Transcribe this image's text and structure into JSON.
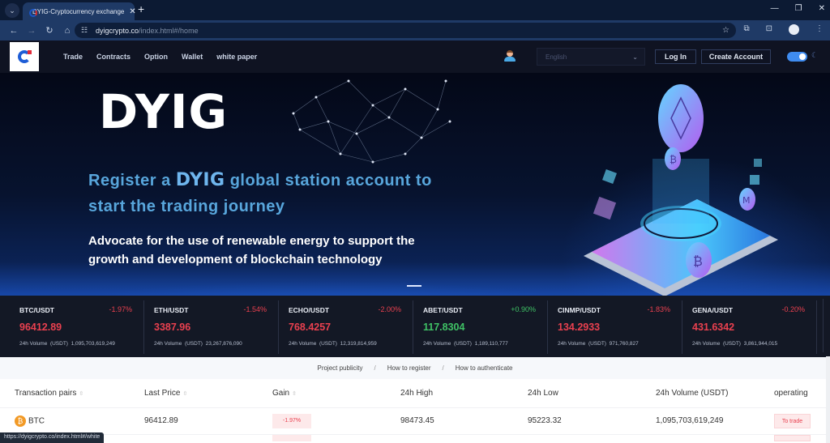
{
  "browser": {
    "tab_title": "DYIG-Cryptocurrency exchange",
    "url_host": "dyigcrypto.co",
    "url_path": "/index.html#/home",
    "status_url": "https://dyigcrypto.co/index.html#/white"
  },
  "header": {
    "nav": [
      "Trade",
      "Contracts",
      "Option",
      "Wallet",
      "white paper"
    ],
    "language": "English",
    "login_label": "Log In",
    "create_label": "Create Account",
    "theme_toggle_on": true
  },
  "hero": {
    "title": "DYIG",
    "sub_prefix": "Register a",
    "sub_brand": "DYIG",
    "sub_suffix": "global station account to",
    "sub_line2": "start the trading journey",
    "desc_line1": "Advocate for the use of renewable energy to support the",
    "desc_line2": "growth and development of blockchain technology"
  },
  "ticker": [
    {
      "pair": "BTC/USDT",
      "change": "-1.97%",
      "price": "96412.89",
      "vol_label": "24h Volume  (USDT)",
      "volume": "1,095,703,619,249",
      "dir": "down"
    },
    {
      "pair": "ETH/USDT",
      "change": "-1.54%",
      "price": "3387.96",
      "vol_label": "24h Volume  (USDT)",
      "volume": "23,267,876,090",
      "dir": "down"
    },
    {
      "pair": "ECHO/USDT",
      "change": "-2.00%",
      "price": "768.4257",
      "vol_label": "24h Volume  (USDT)",
      "volume": "12,319,814,959",
      "dir": "down"
    },
    {
      "pair": "ABET/USDT",
      "change": "+0.90%",
      "price": "117.8304",
      "vol_label": "24h Volume  (USDT)",
      "volume": "1,189,110,777",
      "dir": "up"
    },
    {
      "pair": "CINMP/USDT",
      "change": "-1.83%",
      "price": "134.2933",
      "vol_label": "24h Volume  (USDT)",
      "volume": "971,760,827",
      "dir": "down"
    },
    {
      "pair": "GENA/USDT",
      "change": "-0.20%",
      "price": "431.6342",
      "vol_label": "24h Volume  (USDT)",
      "volume": "3,861,944,015",
      "dir": "down"
    }
  ],
  "links": [
    "Project publicity",
    "How to register",
    "How to authenticate"
  ],
  "table": {
    "headers": [
      "Transaction pairs",
      "Last Price",
      "Gain",
      "24h High",
      "24h Low",
      "24h Volume (USDT)",
      "operating"
    ],
    "rows": [
      {
        "coin": "BTC",
        "last": "96412.89",
        "gain": "-1.97%",
        "high": "98473.45",
        "low": "95223.32",
        "volume": "1,095,703,619,249",
        "action": "To trade"
      }
    ]
  },
  "colors": {
    "down": "#e9404f",
    "up": "#3fc165",
    "accent": "#3f8cf0"
  }
}
